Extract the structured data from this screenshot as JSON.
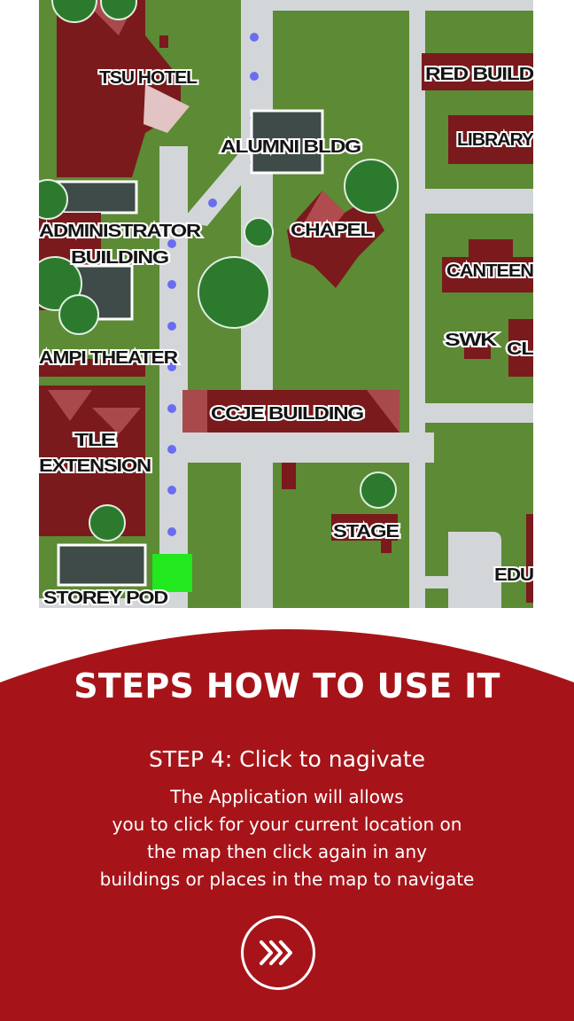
{
  "map": {
    "buildings": {
      "tsu_hotel": "TSU HOTEL",
      "red_building": "RED BUILD",
      "alumni": "ALUMNI BLDG",
      "library": "LIBRARY",
      "administrator_line1": "ADMINISTRATOR",
      "administrator_line2": "BUILDING",
      "chapel": "CHAPEL",
      "canteen": "CANTEEN",
      "ampi_theater": "AMPI THEATER",
      "swk": "SWK",
      "cl": "CL",
      "ccje": "CCJE BUILDING",
      "tle_line1": "TLE",
      "tle_line2": "EXTENSION",
      "stage": "STAGE",
      "storey_pod": "STOREY POD",
      "edu": "EDU"
    },
    "colors": {
      "grass": "#5c8a35",
      "road": "#d3d6d9",
      "building": "#7a1a1d",
      "path_dot": "#6a6df0",
      "current_location": "#22e81e"
    }
  },
  "panel": {
    "title": "STEPS HOW TO USE IT",
    "step_title": "STEP 4: Click to nagivate",
    "body_lines": [
      "The Application will allows",
      "you to click for your current location on",
      "the map then click again in any",
      "buildings or places in the map  to navigate"
    ],
    "next_icon": "triple-chevron-right-icon",
    "background": "#a61419"
  }
}
